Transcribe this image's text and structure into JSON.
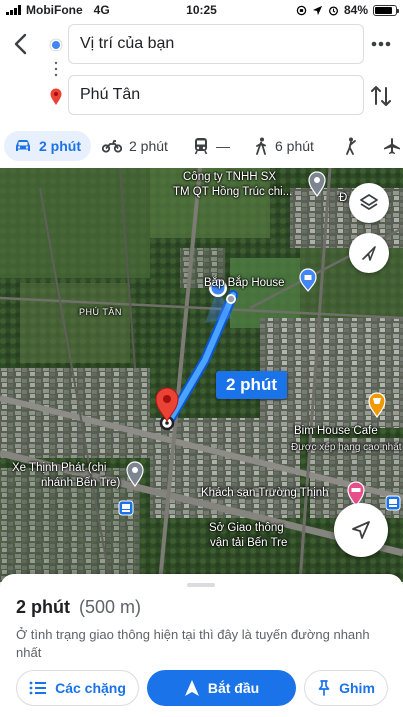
{
  "status_bar": {
    "carrier": "MobiFone",
    "network": "4G",
    "time": "10:25",
    "battery": "84%",
    "battery_level": 0.84
  },
  "search": {
    "origin": "Vị trí của bạn",
    "destination": "Phú Tân"
  },
  "modes": [
    {
      "icon": "car-icon",
      "label": "2 phút",
      "active": true
    },
    {
      "icon": "motorbike-icon",
      "label": "2 phút"
    },
    {
      "icon": "transit-icon",
      "label": "—"
    },
    {
      "icon": "walk-icon",
      "label": "6 phút"
    },
    {
      "icon": "ride-icon",
      "label": ""
    },
    {
      "icon": "flight-icon",
      "label": ""
    }
  ],
  "map": {
    "eta_badge": "2 phút",
    "labels": {
      "company_1": "Công ty TNHH SX",
      "company_2": "TM QT Hồng Trúc chi...",
      "company_edge": "Đ",
      "bap_house": "Bắp Bắp House",
      "area": "PHÚ TÂN",
      "bim_house": "Bim House Cafe",
      "bim_house_rating": "Được xếp hạng cao nhất",
      "xe_1": "Xe Thịnh Phát (chi",
      "xe_2": "nhánh Bến Tre)",
      "hotel": "Khách sạn Trường Thịnh",
      "so_1": "Sở Giao thông",
      "so_2": "vận tải Bến Tre"
    },
    "colors": {
      "route": "#1a73e8",
      "destination_pin": "#ea4335",
      "hotel_pin": "#e84f8a",
      "cafe_pin": "#f29900"
    }
  },
  "sheet": {
    "duration": "2 phút",
    "distance": "(500 m)",
    "description": "Ở tình trạng giao thông hiện tại thì đây là tuyến đường nhanh nhất",
    "steps_label": "Các chặng",
    "start_label": "Bắt đầu",
    "pin_label": "Ghim"
  }
}
